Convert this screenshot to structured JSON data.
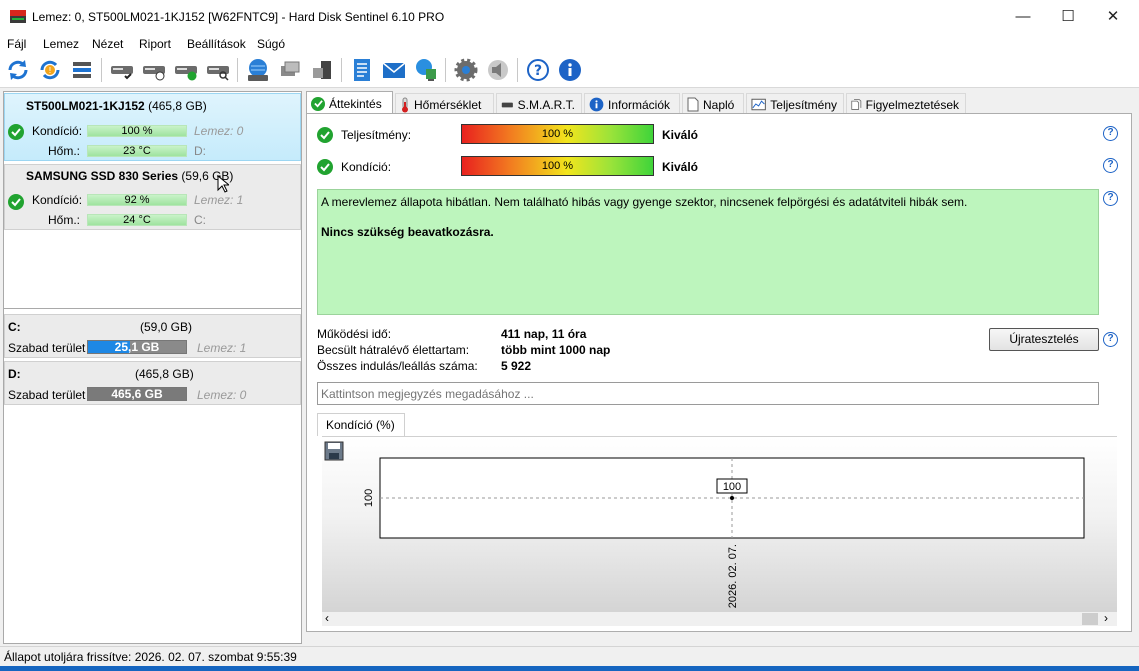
{
  "window": {
    "title": "Lemez: 0, ST500LM021-1KJ152 [W62FNTC9]  -  Hard Disk Sentinel 6.10 PRO",
    "minimize": "—",
    "maximize": "☐",
    "close": "✕"
  },
  "menu": [
    "Fájl",
    "Lemez",
    "Nézet",
    "Riport",
    "Beállítások",
    "Súgó"
  ],
  "toolbar": {
    "icons": [
      "refresh-icon",
      "refresh-warning-icon",
      "disk-list-icon",
      "disk-check-icon",
      "disk-clock-icon",
      "disk-ok-icon",
      "disk-search-icon",
      "globe-disk-icon",
      "network-icon",
      "server-icon",
      "report-icon",
      "email-icon",
      "network-monitor-icon",
      "settings-gear-icon",
      "speaker-icon",
      "help-icon",
      "info-icon"
    ]
  },
  "disks": [
    {
      "name": "ST500LM021-1KJ152",
      "size": "(465,8 GB)",
      "condition_label": "Kondíció:",
      "condition_value": "100 %",
      "condition_pct": 100,
      "temp_label": "Hőm.:",
      "temp_value": "23 °C",
      "disk_ref": "Lemez: 0",
      "drive_ref": "D:"
    },
    {
      "name": "SAMSUNG SSD 830 Series",
      "size": "(59,6 GB)",
      "condition_label": "Kondíció:",
      "condition_value": "92 %",
      "condition_pct": 92,
      "temp_label": "Hőm.:",
      "temp_value": "24 °C",
      "disk_ref": "Lemez: 1",
      "drive_ref": "C:"
    }
  ],
  "volumes": [
    {
      "letter": "C:",
      "size": "(59,0 GB)",
      "free_label": "Szabad terület",
      "free_value": "25,1 GB",
      "free_fraction": 0.43,
      "disk_ref": "Lemez: 1"
    },
    {
      "letter": "D:",
      "size": "(465,8 GB)",
      "free_label": "Szabad terület",
      "free_value": "465,6 GB",
      "free_fraction": 1.0,
      "disk_ref": "Lemez: 0"
    }
  ],
  "tabs": [
    "Áttekintés",
    "Hőmérséklet",
    "S.M.A.R.T.",
    "Információk",
    "Napló",
    "Teljesítmény",
    "Figyelmeztetések"
  ],
  "overview": {
    "performance_label": "Teljesítmény:",
    "performance_value": "100 %",
    "performance_rating": "Kiváló",
    "condition_label": "Kondíció:",
    "condition_value": "100 %",
    "condition_rating": "Kiváló",
    "status_text": "A merevlemez állapota hibátlan. Nem található hibás vagy gyenge szektor, nincsenek felpörgési és adatátviteli hibák sem.",
    "status_action": "Nincs szükség beavatkozásra.",
    "uptime_label": "Működési idő:",
    "uptime_value": "411 nap, 11 óra",
    "lifetime_label": "Becsült hátralévő élettartam:",
    "lifetime_value": "több mint 1000 nap",
    "starts_label": "Összes indulás/leállás száma:",
    "starts_value": "5 922",
    "retest_button": "Újratesztelés",
    "note_placeholder": "Kattintson megjegyzés megadásához ..."
  },
  "chart_tab": "Kondíció  (%)",
  "chart_data": {
    "type": "line",
    "x": [
      "2026. 02. 07."
    ],
    "values": [
      100
    ],
    "point_label": "100",
    "ytick": "100"
  },
  "statusbar": {
    "text": "Állapot utoljára frissítve: 2026. 02. 07. szombat 9:55:39"
  }
}
